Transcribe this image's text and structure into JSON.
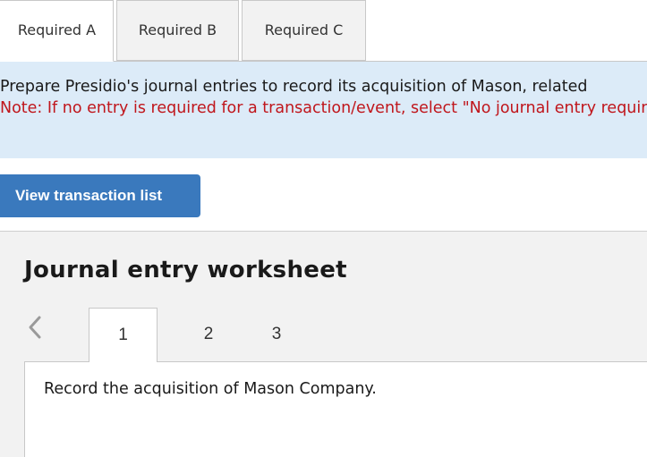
{
  "tabs": [
    {
      "label": "Required A",
      "active": true
    },
    {
      "label": "Required B",
      "active": false
    },
    {
      "label": "Required C",
      "active": false
    }
  ],
  "instructions": {
    "main": "Prepare Presidio's journal entries to record its acquisition of Mason, related",
    "note": "Note: If no entry is required for a transaction/event, select \"No journal entry required\""
  },
  "view_button": {
    "label": "View transaction list"
  },
  "worksheet": {
    "title": "Journal entry worksheet",
    "steps": [
      "1",
      "2",
      "3"
    ],
    "active_step": "1",
    "entry_instruction": "Record the acquisition of Mason Company."
  },
  "colors": {
    "accent_button": "#3a79bd",
    "instructions_bg": "#dcebf8",
    "note_text": "#c0161c",
    "panel_bg": "#f2f2f2"
  },
  "icons": {
    "previous": "chevron-left-icon"
  }
}
